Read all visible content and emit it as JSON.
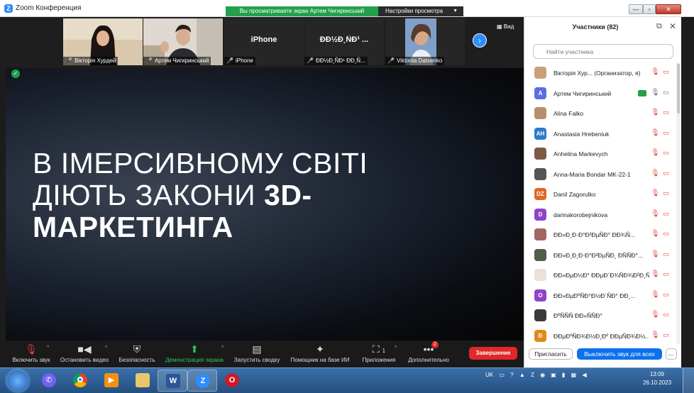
{
  "window": {
    "title": "Zoom Конференция",
    "share_banner": "Вы просматриваете экран Артем Чигиринський",
    "view_settings": "Настройки просмотра",
    "min": "—",
    "max": "▫",
    "close": "✕"
  },
  "strip": {
    "tiles": [
      {
        "name": "Вікторія Хурдей",
        "big": ""
      },
      {
        "name": "Артем Чигиринський",
        "big": ""
      },
      {
        "name": "iPhone",
        "big": "iPhone"
      },
      {
        "name": "ÐÐ½Ð¸ÑÐ¹ ÐÐ¸Ñ...",
        "big": "ÐÐ½Ð¸ÑÐ¹ ..."
      },
      {
        "name": "Viktoriia Datsenko",
        "big": ""
      }
    ],
    "view_label": "Вид"
  },
  "slide": {
    "line1": "В ІМЕРСИВНОМУ СВІТІ",
    "line2_normal": "ДІЮТЬ ЗАКОНИ ",
    "line2_bold": "3D-",
    "line3": "МАРКЕТИНГА"
  },
  "toolbar": {
    "unmute": "Включить звук",
    "stop_video": "Остановить видео",
    "security": "Безопасность",
    "share_screen": "Демонстрация экрана",
    "summary": "Запустить сводку",
    "ai_assistant": "Помощник на базе ИИ",
    "apps": "Приложения",
    "apps_count": "1",
    "more": "Дополнительно",
    "more_badge": "2",
    "end": "Завершение"
  },
  "panel": {
    "title": "Участники (82)",
    "search_placeholder": "Найти участника",
    "participants": [
      {
        "name": "Вікторія Хур...  (Организатор, я)",
        "initials": "",
        "color": "#c9a07a",
        "mic": "off",
        "cam": "off"
      },
      {
        "name": "Артем Чигиринський",
        "initials": "A",
        "color": "#5b6ee1",
        "mic": "on",
        "cam": "on",
        "sharing": true
      },
      {
        "name": "Alina Falko",
        "initials": "",
        "color": "#b88f6b",
        "mic": "off",
        "cam": "off"
      },
      {
        "name": "Anastasia Hrebeniuk",
        "initials": "AH",
        "color": "#2f78c9",
        "mic": "off",
        "cam": "off"
      },
      {
        "name": "Anhelina Markevych",
        "initials": "",
        "color": "#7d5a48",
        "mic": "off",
        "cam": "off"
      },
      {
        "name": "Anna-Maria Bondar MK-22-1",
        "initials": "",
        "color": "#555555",
        "mic": "off",
        "cam": "off"
      },
      {
        "name": "Danil Zagorulko",
        "initials": "DZ",
        "color": "#e0662a",
        "mic": "off",
        "cam": "off"
      },
      {
        "name": "darinakorobejnikova",
        "initials": "D",
        "color": "#8e44c8",
        "mic": "off",
        "cam": "off"
      },
      {
        "name": "ÐÐ»Ð¸Ð·Ð°Ð²ÐµÑÐ° ÐÐ¾Ñ...",
        "initials": "",
        "color": "#a06860",
        "mic": "off",
        "cam": "off"
      },
      {
        "name": "ÐÐ»Ð¸Ð¸Ð·Ð°Ð²ÐµÑÐ¸ ÐÑÑÐ°...",
        "initials": "",
        "color": "#4f5e45",
        "mic": "off",
        "cam": "off"
      },
      {
        "name": "ÐÐ»ÐµÐ½Ð° ÐÐµÐ´Ð¾ÑÐ¾Ð²Ð¸Ñ",
        "initials": "",
        "color": "#e8e2d8",
        "mic": "off",
        "cam": "off"
      },
      {
        "name": "ÐÐ»ÐµÐºÑÐ°Ð½Ð´ÑÐ° ÐÐ¸...",
        "initials": "O",
        "color": "#8e44c8",
        "mic": "off",
        "cam": "off"
      },
      {
        "name": "ÐºÑÑÑ ÐÐ»ÑÑÐ°",
        "initials": "",
        "color": "#3a3a3a",
        "mic": "off",
        "cam": "off"
      },
      {
        "name": "ÐÐµÐºÑÐ¾Ð½Ð¸Ðº ÐÐµÑÐ¾Ð½...",
        "initials": "Ð",
        "color": "#e08a1a",
        "mic": "off",
        "cam": "off"
      }
    ],
    "invite": "Пригласить",
    "mute_all": "Выключить звук для всех",
    "more": "…"
  },
  "taskbar": {
    "lang": "UK",
    "time": "13:09",
    "date": "26.10.2023"
  }
}
